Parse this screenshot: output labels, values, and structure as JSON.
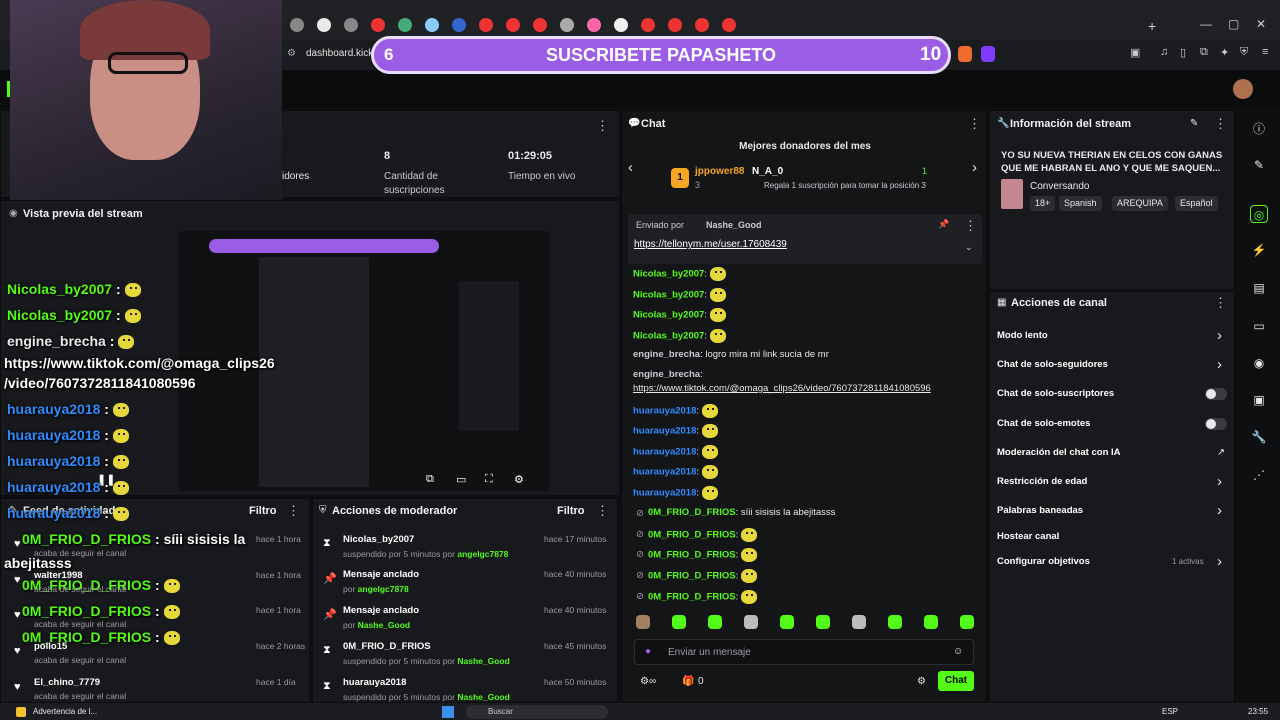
{
  "browser": {
    "address": "dashboard.kick.",
    "tab_close": "✕",
    "new_tab": "+"
  },
  "banner": {
    "left_count": "6",
    "text": "SUSCRIBETE PAPASHETO",
    "right_count": "10"
  },
  "stats": {
    "partial_label": "idores",
    "subs_value": "8",
    "subs_label_1": "Cantidad de",
    "subs_label_2": "suscripciones",
    "time_value": "01:29:05",
    "time_label": "Tiempo en vivo"
  },
  "preview": {
    "title": "Vista previa del stream"
  },
  "overlay_chat": [
    {
      "user": "Nicolas_by2007",
      "text": " :",
      "color": "#53fc18"
    },
    {
      "user": "Nicolas_by2007",
      "text": " :",
      "color": "#53fc18"
    },
    {
      "user": "engine_brecha",
      "text": " :",
      "color": "#e7e8ea"
    },
    {
      "user": "https://www.tiktok.com/@omaga_clips26",
      "text": "",
      "color": "#ffffff"
    },
    {
      "user": "/video/7607372811841080596",
      "text": "",
      "color": "#ffffff"
    },
    {
      "user": "huarauya2018",
      "text": " :",
      "color": "#2f8cff"
    },
    {
      "user": "huarauya2018",
      "text": " :",
      "color": "#2f8cff"
    },
    {
      "user": "huarauya2018",
      "text": " :",
      "color": "#2f8cff"
    },
    {
      "user": "huarauya2018",
      "text": " :",
      "color": "#2f8cff"
    },
    {
      "user": "huarauya2018",
      "text": " :",
      "color": "#2f8cff"
    },
    {
      "user": "0M_FRIO_D_FRIOS",
      "text": " : síii sisisis la",
      "color": "#53fc18"
    },
    {
      "user": "abejitasss",
      "text": "",
      "color": "#ffffff"
    },
    {
      "user": "0M_FRIO_D_FRIOS",
      "text": " :",
      "color": "#53fc18"
    },
    {
      "user": "0M_FRIO_D_FRIOS",
      "text": " :",
      "color": "#53fc18"
    },
    {
      "user": "0M_FRIO_D_FRIOS",
      "text": " :",
      "color": "#53fc18"
    }
  ],
  "feed": {
    "title": "Feed de actividades",
    "filter": "Filtro",
    "items": [
      {
        "user": "",
        "sub": "acaba de seguir el canal",
        "time": "hace 1 hora"
      },
      {
        "user": "walter1998",
        "sub": "acaba de seguir el canal",
        "time": "hace 1 hora"
      },
      {
        "user": "",
        "sub": "acaba de seguir el canal",
        "time": "hace 1 hora"
      },
      {
        "user": "pollo15",
        "sub": "acaba de seguir el canal",
        "time": "hace 2 horas"
      },
      {
        "user": "El_chino_7779",
        "sub": "acaba de seguir el canal",
        "time": "hace 1 día"
      }
    ]
  },
  "mod": {
    "title": "Acciones de moderador",
    "filter": "Filtro",
    "items": [
      {
        "title": "Nicolas_by2007",
        "pre": "suspendido por 5 minutos por ",
        "by": "angelgc7878",
        "time": "hace 17 minutos",
        "icon": "⧗"
      },
      {
        "title": "Mensaje anclado",
        "pre": "por ",
        "by": "angelgc7878",
        "time": "hace 40 minutos",
        "icon": "📌"
      },
      {
        "title": "Mensaje anclado",
        "pre": "por ",
        "by": "Nashe_Good",
        "time": "hace 40 minutos",
        "icon": "📌"
      },
      {
        "title": "0M_FRIO_D_FRIOS",
        "pre": "suspendido por 5 minutos por ",
        "by": "Nashe_Good",
        "time": "hace 45 minutos",
        "icon": "⧗"
      },
      {
        "title": "huarauya2018",
        "pre": "suspendido por 5 minutos por ",
        "by": "Nashe_Good",
        "time": "hace 50 minutos",
        "icon": "⧗"
      }
    ]
  },
  "chat": {
    "title": "Chat",
    "donors_title": "Mejores donadores del mes",
    "donor1_name": "jppower88",
    "donor1_count": "3",
    "donor1_rank": "1",
    "donor2_name": "N_A_0",
    "donor2_count": "1",
    "donor2_hint": "Regala 1 suscripción para tomar la posición 3",
    "pinned_by_label": "Enviado por",
    "pinned_by": "Nashe_Good",
    "pinned_link": "https://tellonym.me/user.17608439",
    "messages": [
      {
        "user": "Nicolas_by2007",
        "cls": "u-green",
        "text": "",
        "emote": true
      },
      {
        "user": "Nicolas_by2007",
        "cls": "u-green",
        "text": "",
        "emote": true
      },
      {
        "user": "Nicolas_by2007",
        "cls": "u-green",
        "text": "",
        "emote": true
      },
      {
        "user": "Nicolas_by2007",
        "cls": "u-green",
        "text": "",
        "emote": true
      },
      {
        "user": "engine_brecha",
        "cls": "u-dim",
        "text": " logro mira mi link sucia de mr",
        "emote": false
      },
      {
        "user": "engine_brecha",
        "cls": "u-dim",
        "text": "",
        "emote": false
      },
      {
        "user": "huarauya2018",
        "cls": "u-blue",
        "text": "",
        "emote": true
      },
      {
        "user": "huarauya2018",
        "cls": "u-blue",
        "text": "",
        "emote": true
      },
      {
        "user": "huarauya2018",
        "cls": "u-blue",
        "text": "",
        "emote": true
      },
      {
        "user": "huarauya2018",
        "cls": "u-blue",
        "text": "",
        "emote": true
      },
      {
        "user": "huarauya2018",
        "cls": "u-blue",
        "text": "",
        "emote": true
      },
      {
        "user": "0M_FRIO_D_FRIOS",
        "cls": "u-green",
        "text": " síii sisisis la abejitasss",
        "emote": false
      },
      {
        "user": "0M_FRIO_D_FRIOS",
        "cls": "u-green",
        "text": "",
        "emote": true
      },
      {
        "user": "0M_FRIO_D_FRIOS",
        "cls": "u-green",
        "text": "",
        "emote": true
      },
      {
        "user": "0M_FRIO_D_FRIOS",
        "cls": "u-green",
        "text": "",
        "emote": true
      },
      {
        "user": "0M_FRIO_D_FRIOS",
        "cls": "u-green",
        "text": "",
        "emote": true
      }
    ],
    "link_msg": "https://www.tiktok.com/@omaga_clips26/video/7607372811841080596",
    "input_placeholder": "Enviar un mensaje",
    "gift_count": "0",
    "send_label": "Chat"
  },
  "info": {
    "title": "Información del stream",
    "stream_title": "YO SU NUEVA THERIAN EN CELOS CON GANAS QUE ME HABRAN EL ANO Y QUE ME SAQUEN...",
    "category": "Conversando",
    "tags": [
      "18+",
      "Spanish",
      "AREQUIPA",
      "Español"
    ]
  },
  "actions": {
    "title": "Acciones de canal",
    "items": [
      {
        "label": "Modo lento",
        "ctrl": "chevron"
      },
      {
        "label": "Chat de solo-seguidores",
        "ctrl": "chevron"
      },
      {
        "label": "Chat de solo-suscriptores",
        "ctrl": "toggle"
      },
      {
        "label": "Chat de solo-emotes",
        "ctrl": "toggle"
      },
      {
        "label": "Moderación del chat con IA",
        "ctrl": "external"
      },
      {
        "label": "Restricción de edad",
        "ctrl": "chevron"
      },
      {
        "label": "Palabras baneadas",
        "ctrl": "chevron"
      },
      {
        "label": "Hostear canal",
        "ctrl": "none"
      },
      {
        "label": "Configurar objetivos",
        "ctrl": "chevron",
        "badge": "1 activas"
      }
    ]
  },
  "taskbar": {
    "notice": "Advertencia de l...",
    "search": "Buscar",
    "lang": "ESP",
    "clock": "23:55"
  },
  "colors": {
    "accent": "#53fc18",
    "banner": "#9b5de5",
    "link": "#2f8cff"
  }
}
